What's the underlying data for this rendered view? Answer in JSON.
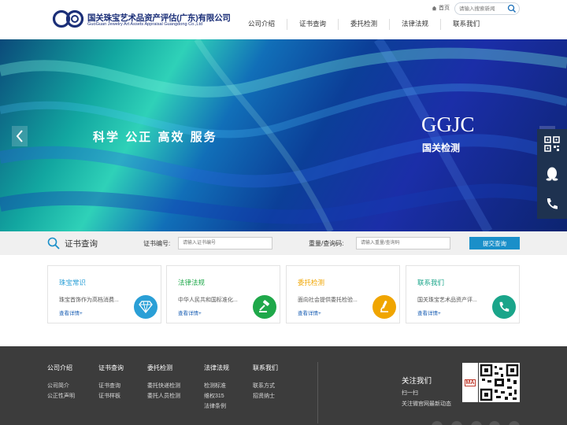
{
  "header": {
    "brand_cn": "国关珠宝艺术品资产评估(广东)有限公司",
    "brand_en": "GuoGuan Jewelry Art Assets Appraisal Guangdong Co.,Ltd",
    "home_label": "首页",
    "search_placeholder": "请输入搜索新闻",
    "brand_color": "#1b2f78"
  },
  "nav": {
    "items": [
      {
        "label": "公司介绍"
      },
      {
        "label": "证书查询"
      },
      {
        "label": "委托检测"
      },
      {
        "label": "法律法规"
      },
      {
        "label": "联系我们"
      }
    ]
  },
  "banner": {
    "slogan": "科学  公正  高效  服务",
    "mark": "GGJC",
    "mark_cn": "国关检测"
  },
  "side_widget": {
    "icons": [
      "qr-code-icon",
      "qq-icon",
      "phone-icon"
    ]
  },
  "query": {
    "title": "证书查询",
    "cert_label": "证书编号:",
    "cert_placeholder": "请输入证书编号",
    "weight_label": "重量/查询码:",
    "weight_placeholder": "请输入重量/查询码",
    "submit_label": "提交查询",
    "accent": "#1a8fc9"
  },
  "cards": [
    {
      "title": "珠宝常识",
      "desc": "珠宝首饰作为高档消费...",
      "more": "查看详情+",
      "color": "#2a9fd6",
      "icon": "diamond-icon"
    },
    {
      "title": "法律法规",
      "desc": "中华人民共和国标准化...",
      "more": "查看详情+",
      "color": "#1fa84a",
      "icon": "gavel-icon"
    },
    {
      "title": "委托检测",
      "desc": "面向社会提供委托检验...",
      "more": "查看详情+",
      "color": "#f0a500",
      "icon": "microscope-icon"
    },
    {
      "title": "联系我们",
      "desc": "国关珠宝艺术品资产评...",
      "more": "查看详情+",
      "color": "#1aa58a",
      "icon": "phone-icon"
    }
  ],
  "footer": {
    "columns": [
      {
        "head": "公司介绍",
        "links": [
          "公司简介",
          "公正性声明"
        ]
      },
      {
        "head": "证书查询",
        "links": [
          "证书查询",
          "证书样板"
        ]
      },
      {
        "head": "委托检测",
        "links": [
          "委托快递检测",
          "委托人员检测"
        ]
      },
      {
        "head": "法律法规",
        "links": [
          "检测标准",
          "维权315",
          "法律条例"
        ]
      },
      {
        "head": "联系我们",
        "links": [
          "联系方式",
          "招贤纳士"
        ]
      }
    ],
    "follow_title": "关注我们",
    "follow_scan": "扫一扫",
    "follow_desc": "关注微官网最新动态",
    "badge_text": "MA"
  }
}
